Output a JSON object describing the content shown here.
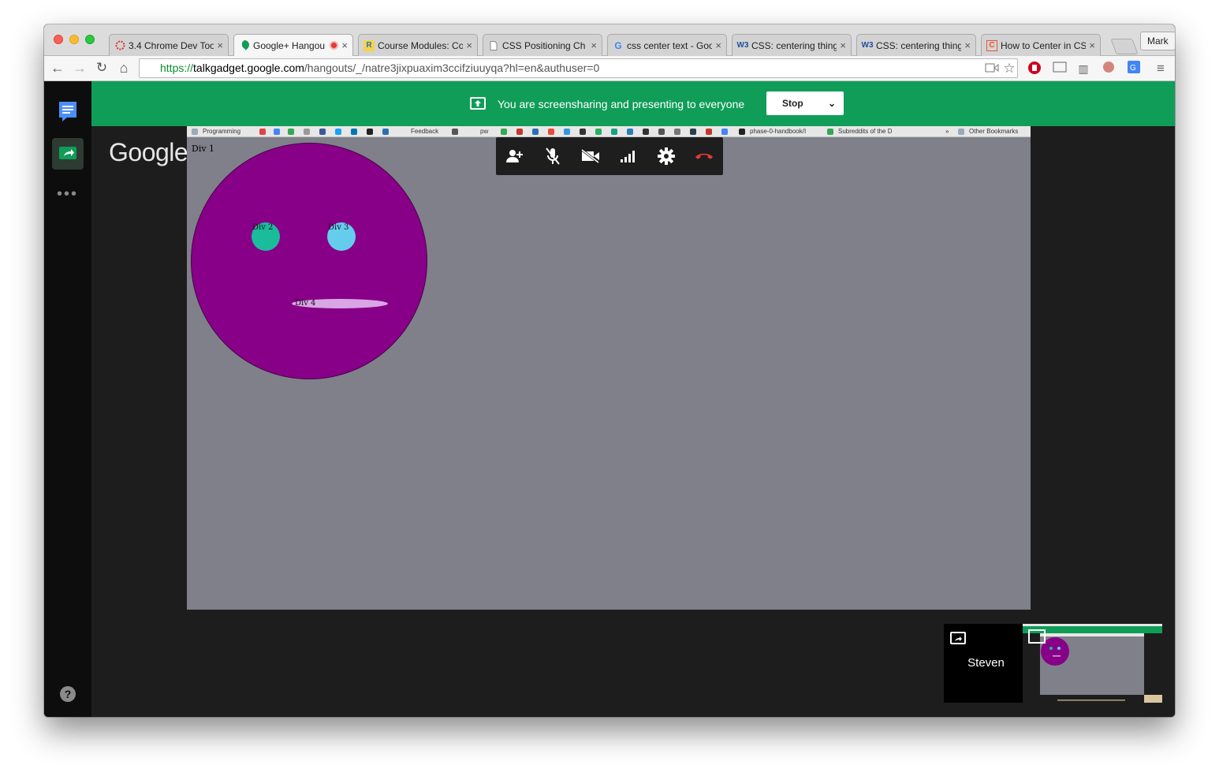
{
  "browser": {
    "tabs": [
      {
        "title": "3.4 Chrome Dev Too",
        "favicon": "chrome-devtools-icon",
        "color": "#d33"
      },
      {
        "title": "Google+ Hangou",
        "favicon": "hangouts-icon",
        "color": "#0f9d58",
        "active": true
      },
      {
        "title": "Course Modules: Co",
        "favicon": "course-icon",
        "color": "#2c6fb7"
      },
      {
        "title": "CSS Positioning Ch",
        "favicon": "document-icon",
        "color": "#777"
      },
      {
        "title": "css center text - Goo",
        "favicon": "google-icon",
        "color": "#4285f4"
      },
      {
        "title": "CSS: centering thing",
        "favicon": "w3c-icon",
        "color": "#1e4f9c"
      },
      {
        "title": "CSS: centering thing",
        "favicon": "w3c-icon",
        "color": "#1e4f9c"
      },
      {
        "title": "How to Center in CS",
        "favicon": "css-tricks-icon",
        "color": "#e8562e"
      }
    ],
    "profile": "Mark",
    "url": {
      "scheme": "https://",
      "host": "talkgadget.google.com",
      "path": "/hangouts/_/natre3jixpuaxim3ccifziuuyqa?hl=en&authuser=0"
    }
  },
  "hangouts": {
    "logo": "Google",
    "banner_text": "You are screensharing and presenting to everyone",
    "stop_label": "Stop",
    "participant_name": "Steven"
  },
  "shared_screen": {
    "bookmarks": {
      "programming": "Programming",
      "feedback": "Feedback",
      "pw": "pw",
      "handbook": "phase-0-handbook/I",
      "subreddits": "Subreddits of the D",
      "more": "»",
      "other": "Other Bookmarks"
    },
    "labels": {
      "div1": "Div 1",
      "div2": "Div 2",
      "div3": "Div 3",
      "div4": "Div 4"
    }
  },
  "colors": {
    "banner": "#109d58",
    "face": "#870087",
    "eye_left": "#1abc9c",
    "eye_right": "#66ccee",
    "mouth": "#d8a6e4",
    "end_call": "#e53935"
  }
}
